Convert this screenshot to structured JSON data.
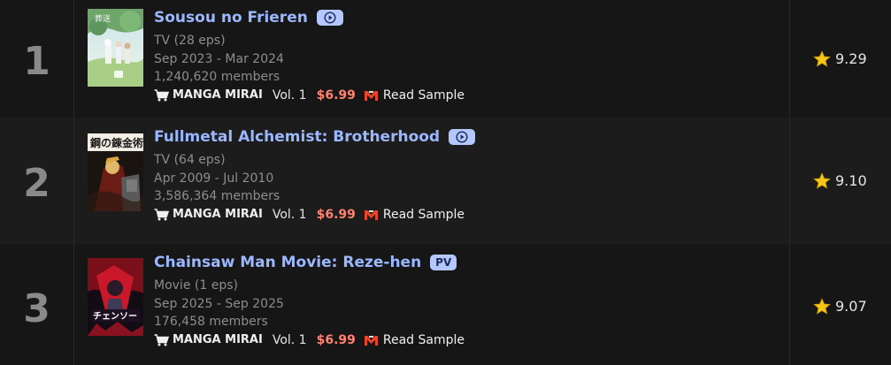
{
  "entries": [
    {
      "rank": "1",
      "title": "Sousou no Frieren",
      "badge": "play-icon",
      "badge_text": "",
      "type": "TV (28 eps)",
      "dates": "Sep 2023 - Mar 2024",
      "members": "1,240,620 members",
      "store": "MANGA MIRAI",
      "volume": "Vol. 1",
      "price": "$6.99",
      "sample": "Read Sample",
      "score": "9.29"
    },
    {
      "rank": "2",
      "title": "Fullmetal Alchemist: Brotherhood",
      "badge": "play-icon",
      "badge_text": "",
      "type": "TV (64 eps)",
      "dates": "Apr 2009 - Jul 2010",
      "members": "3,586,364 members",
      "store": "MANGA MIRAI",
      "volume": "Vol. 1",
      "price": "$6.99",
      "sample": "Read Sample",
      "score": "9.10"
    },
    {
      "rank": "3",
      "title": "Chainsaw Man Movie: Reze-hen",
      "badge": "pv",
      "badge_text": "PV",
      "type": "Movie (1 eps)",
      "dates": "Sep 2025 - Sep 2025",
      "members": "176,458 members",
      "store": "MANGA MIRAI",
      "volume": "Vol. 1",
      "price": "$6.99",
      "sample": "Read Sample",
      "score": "9.07"
    }
  ],
  "colors": {
    "title": "#9bb7ff",
    "badge_bg": "#b4c7ff",
    "price": "#ff8270",
    "star": "#f5c518",
    "manga_mirai_icon": "#e8442a"
  }
}
